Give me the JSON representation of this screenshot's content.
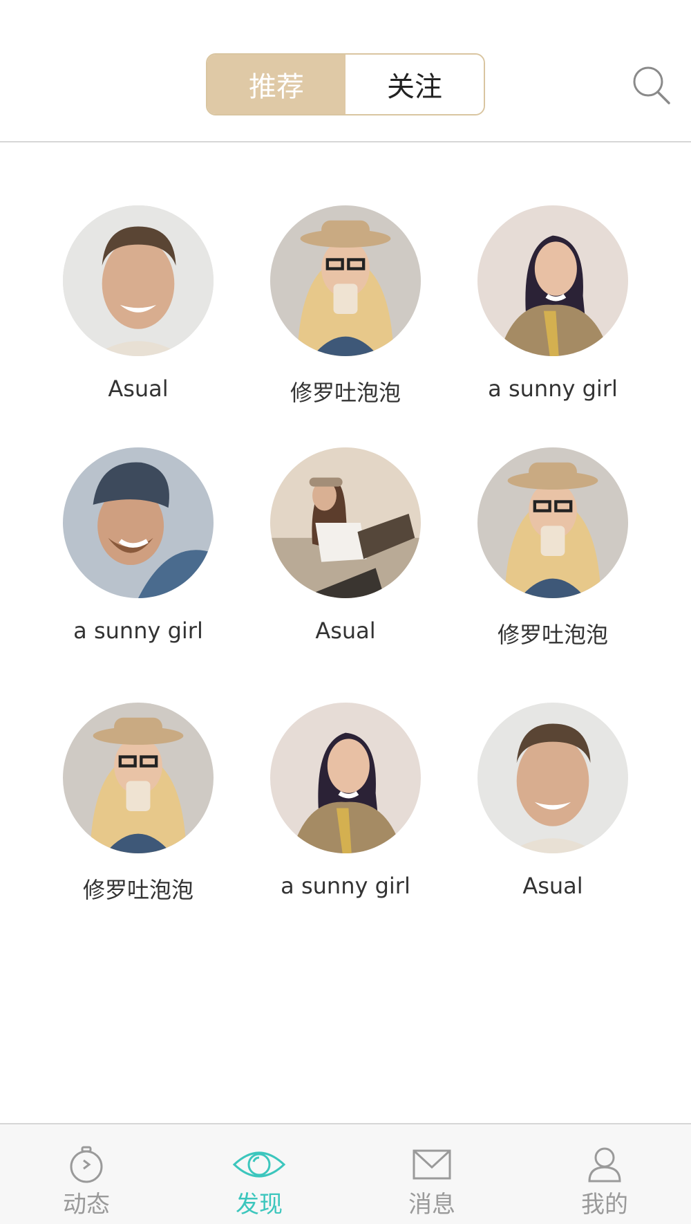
{
  "header": {
    "tabs": [
      {
        "label": "推荐",
        "active": true
      },
      {
        "label": "关注",
        "active": false
      }
    ],
    "search_icon": "search-icon"
  },
  "grid": {
    "users": [
      {
        "name": "Asual",
        "avatar": "man-smiling"
      },
      {
        "name": "修罗吐泡泡",
        "avatar": "woman-hat-coffee"
      },
      {
        "name": "a sunny girl",
        "avatar": "woman-headphones"
      },
      {
        "name": "a sunny girl",
        "avatar": "man-beanie"
      },
      {
        "name": "Asual",
        "avatar": "woman-cap-sitting"
      },
      {
        "name": "修罗吐泡泡",
        "avatar": "woman-hat-coffee"
      },
      {
        "name": "修罗吐泡泡",
        "avatar": "woman-hat-coffee"
      },
      {
        "name": "a sunny girl",
        "avatar": "woman-headphones"
      },
      {
        "name": "Asual",
        "avatar": "man-smiling"
      }
    ]
  },
  "tabbar": {
    "items": [
      {
        "label": "动态",
        "icon": "stopwatch-icon",
        "active": false
      },
      {
        "label": "发现",
        "icon": "eye-icon",
        "active": true
      },
      {
        "label": "消息",
        "icon": "envelope-icon",
        "active": false
      },
      {
        "label": "我的",
        "icon": "user-icon",
        "active": false
      }
    ]
  },
  "colors": {
    "accent_gold": "#dfc9a6",
    "active_tab": "#3cc6bd",
    "inactive_tab": "#9a9a9a"
  }
}
